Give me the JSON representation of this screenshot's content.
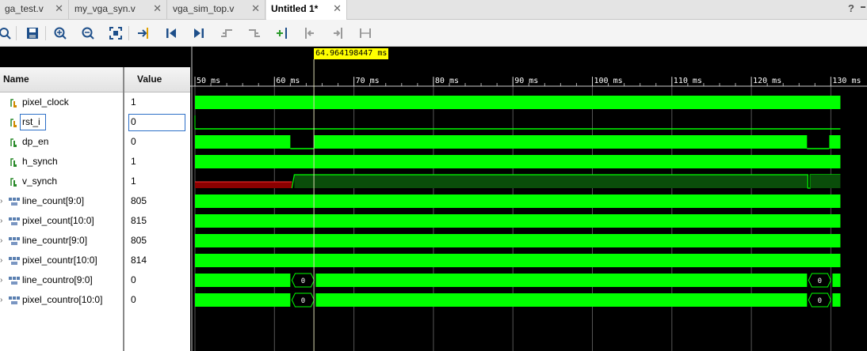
{
  "tabs": [
    {
      "label": "ga_test.v"
    },
    {
      "label": "my_vga_syn.v"
    },
    {
      "label": "vga_sim_top.v"
    },
    {
      "label": "Untitled 1*"
    }
  ],
  "tab_controls": {
    "help": "?"
  },
  "toolbar": {
    "icons": [
      "search-icon",
      "save-icon",
      "zoom-in-icon",
      "zoom-out-icon",
      "zoom-fit-icon",
      "go-to-cursor-icon",
      "go-to-time-0-icon",
      "go-to-last-time-icon",
      "previous-transition-icon",
      "next-transition-icon",
      "add-marker-icon",
      "previous-marker-icon",
      "next-marker-icon",
      "swap-cursors-icon"
    ]
  },
  "columns": {
    "name": "Name",
    "value": "Value"
  },
  "signals": [
    {
      "name": "pixel_clock",
      "value": "1",
      "kind": "bit"
    },
    {
      "name": "rst_i",
      "value": "0",
      "kind": "bit"
    },
    {
      "name": "dp_en",
      "value": "0",
      "kind": "bit"
    },
    {
      "name": "h_synch",
      "value": "1",
      "kind": "bit"
    },
    {
      "name": "v_synch",
      "value": "1",
      "kind": "bit"
    },
    {
      "name": "line_count[9:0]",
      "value": "805",
      "kind": "bus"
    },
    {
      "name": "pixel_count[10:0]",
      "value": "815",
      "kind": "bus"
    },
    {
      "name": "line_countr[9:0]",
      "value": "805",
      "kind": "bus"
    },
    {
      "name": "pixel_countr[10:0]",
      "value": "814",
      "kind": "bus"
    },
    {
      "name": "line_countro[9:0]",
      "value": "0",
      "kind": "bus"
    },
    {
      "name": "pixel_countro[10:0]",
      "value": "0",
      "kind": "bus"
    }
  ],
  "waveform": {
    "cursor_time": "64.964198447 ms",
    "cursor_time_value_ms": 64.964198447,
    "ticks": [
      "50 ms",
      "60 ms",
      "70 ms",
      "80 ms",
      "90 ms",
      "100 ms",
      "110 ms",
      "120 ms",
      "130 ms"
    ],
    "tick_values_ms": [
      50,
      60,
      70,
      80,
      90,
      100,
      110,
      120,
      130
    ],
    "bus_labels": {
      "line_countro": [
        "0",
        "0"
      ],
      "pixel_countro": [
        "0",
        "0"
      ]
    },
    "colors": {
      "signal": "#00ff00",
      "dim_signal": "#0a4d0a",
      "red_segment": "#8b0000",
      "cursor": "#ffff00",
      "background": "#000000",
      "grid": "#555555"
    }
  }
}
